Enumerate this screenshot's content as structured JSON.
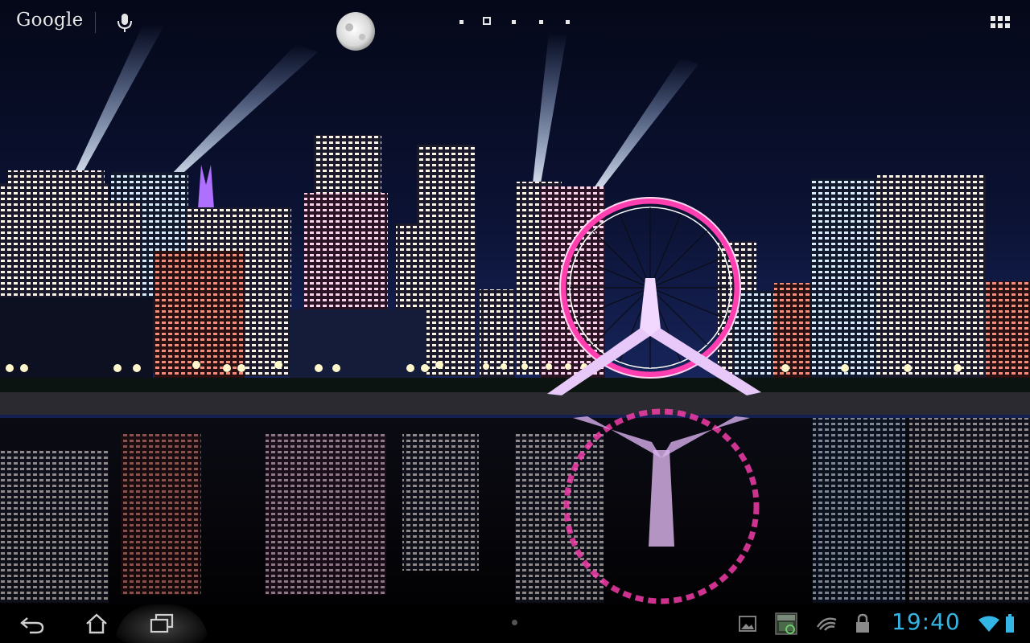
{
  "search": {
    "brand": "Google",
    "voice_icon": "mic-icon"
  },
  "home_pager": {
    "page_count": 5,
    "active_page": 2
  },
  "apps_button": {
    "icon": "all-apps-grid-icon"
  },
  "wallpaper": {
    "scene": "night-city-ferris-wheel"
  },
  "navigation": {
    "back_icon": "back-icon",
    "home_icon": "home-icon",
    "recents_icon": "recent-apps-icon"
  },
  "status_bar": {
    "time": "19:40",
    "notification_icons": [
      "gallery-notification-icon",
      "screenshot-notification-icon",
      "sync-notification-icon",
      "lock-notification-icon"
    ],
    "wifi_icon": "wifi-icon",
    "battery_icon": "battery-icon",
    "accent_color": "#33b5e5"
  }
}
